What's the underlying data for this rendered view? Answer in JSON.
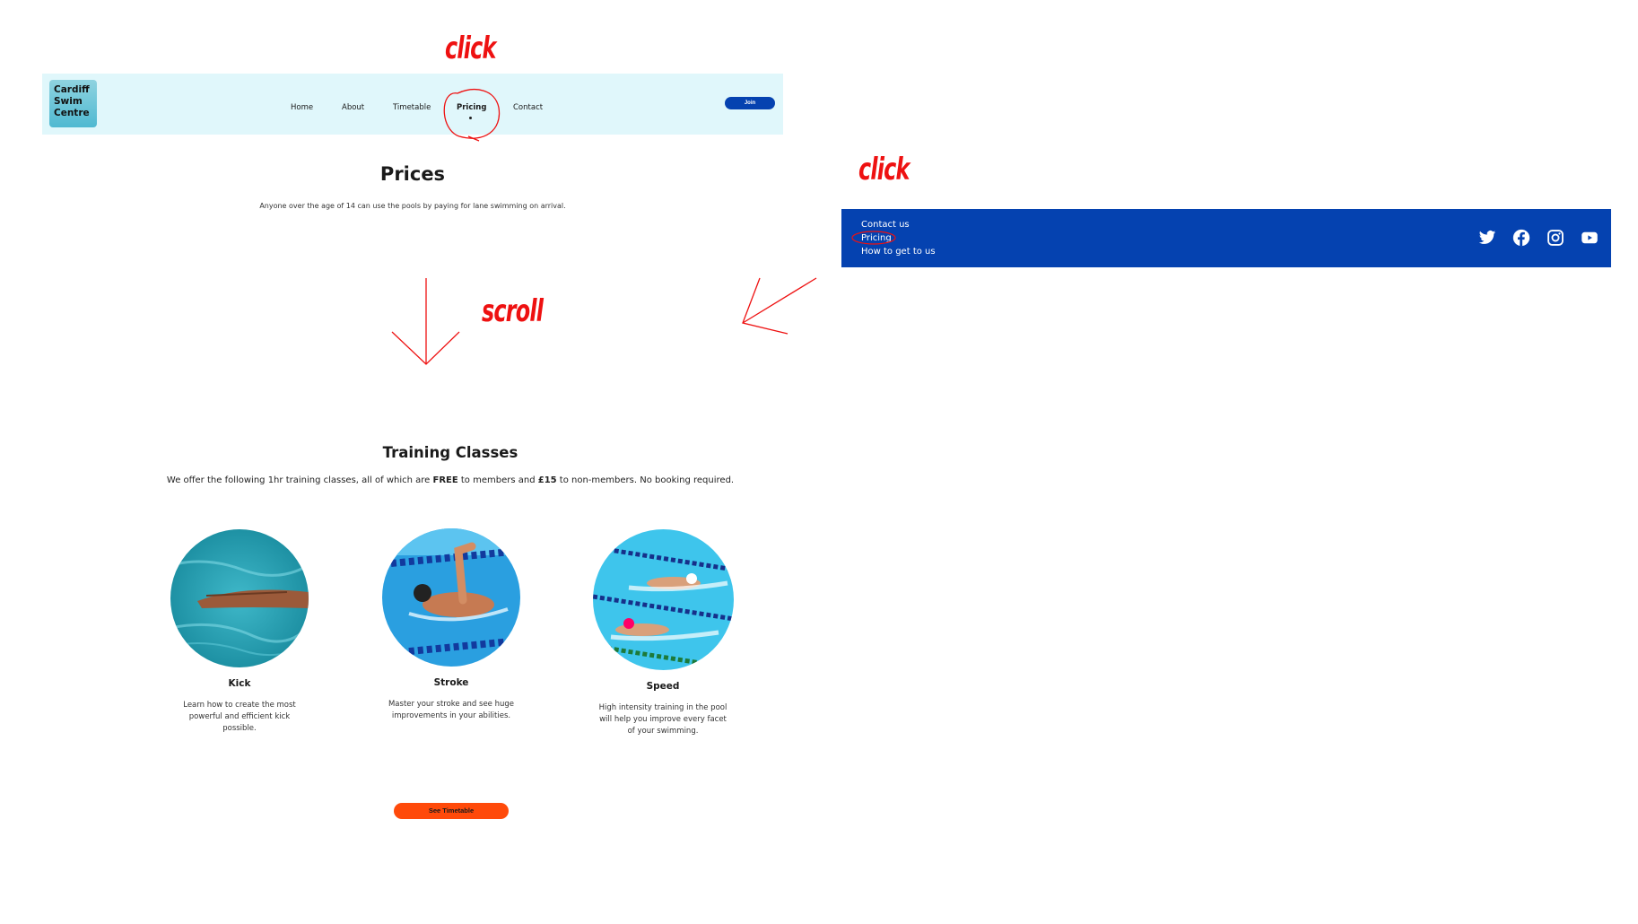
{
  "navbar": {
    "logo_lines": [
      "Cardiff",
      "Swim",
      "Centre"
    ],
    "items": [
      {
        "label": "Home"
      },
      {
        "label": "About"
      },
      {
        "label": "Timetable"
      },
      {
        "label": "Pricing",
        "active": true
      },
      {
        "label": "Contact"
      }
    ],
    "join_label": "Join"
  },
  "prices": {
    "title": "Prices",
    "text": "Anyone over the age of 14 can use the pools by paying for lane swimming on arrival."
  },
  "training": {
    "title": "Training Classes",
    "text_before": "We offer the following 1hr training classes, all of which are ",
    "free": "FREE",
    "text_middle": " to members and ",
    "price": "£15",
    "text_after": " to non-members. No booking required.",
    "cards": [
      {
        "title": "Kick",
        "desc": "Learn how to create the most powerful and efficient kick possible."
      },
      {
        "title": "Stroke",
        "desc": "Master your stroke and see huge improvements in your abilities."
      },
      {
        "title": "Speed",
        "desc": "High intensity training in the pool will help you improve every facet of your swimming."
      }
    ],
    "button_label": "See Timetable"
  },
  "annotations": {
    "click_top": "click",
    "click_right": "click",
    "scroll": "scroll"
  },
  "footer": {
    "links": [
      "Contact us",
      "Pricing",
      "How to get to us"
    ],
    "social_icons": [
      "twitter-icon",
      "facebook-icon",
      "instagram-icon",
      "youtube-icon"
    ]
  },
  "colors": {
    "nav_bg": "#e0f7fb",
    "brand_blue": "#0542b0",
    "accent_orange": "#ff4a0a",
    "annotation_red": "#ee1111"
  }
}
